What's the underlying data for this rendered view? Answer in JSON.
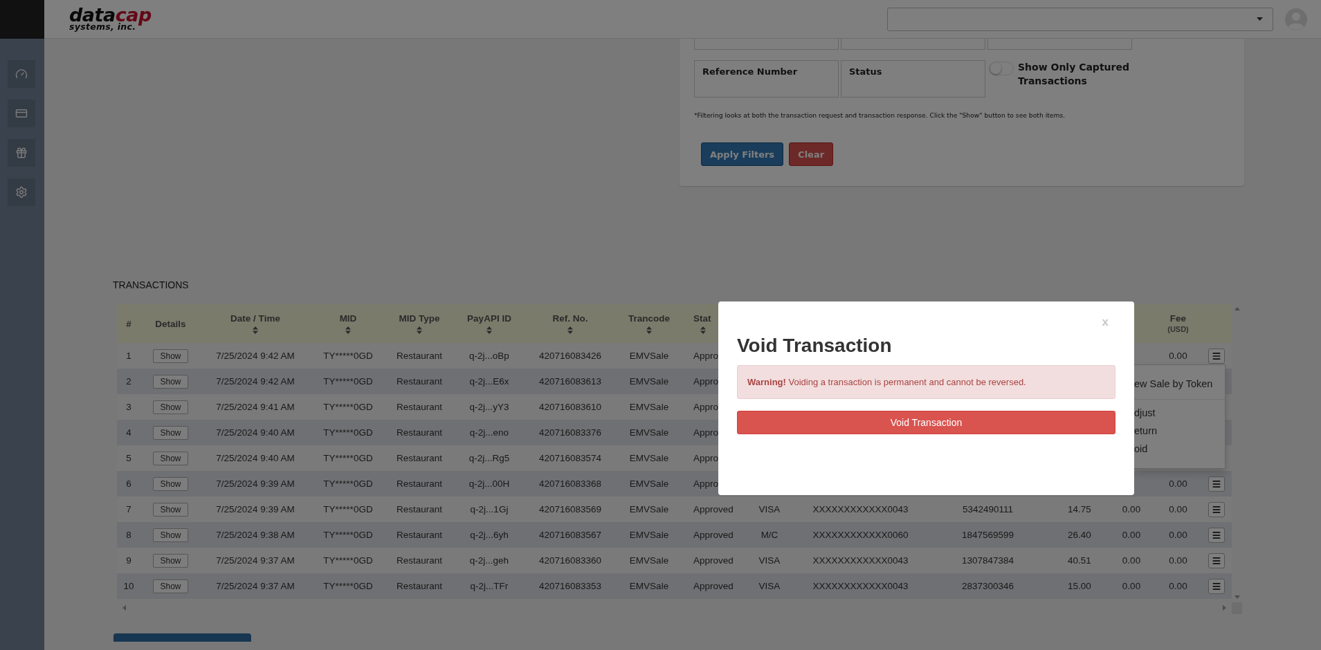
{
  "header": {
    "logo": {
      "part_1": "data",
      "part_2": "cap",
      "tagline": "systems, inc."
    }
  },
  "filters": {
    "fields": [
      {
        "label": "Reference Number"
      },
      {
        "label": "Status"
      }
    ],
    "captured_toggle": {
      "label": "Show Only Captured Transactions",
      "on": false
    },
    "note": "*Filtering looks at both the transaction request and transaction response. Click the \"Show\" button to see both items.",
    "buttons": [
      {
        "label": "Apply Filters",
        "kind": "primary"
      },
      {
        "label": "Clear",
        "kind": "danger"
      }
    ]
  },
  "transactions": {
    "title": "TRANSACTIONS",
    "columns": [
      {
        "label": "#",
        "sortable": false
      },
      {
        "label": "Details",
        "sortable": false
      },
      {
        "label": "Date / Time",
        "sortable": true
      },
      {
        "label": "MID",
        "sortable": true
      },
      {
        "label": "MID Type",
        "sortable": true
      },
      {
        "label": "PayAPI ID",
        "sortable": true
      },
      {
        "label": "Ref. No.",
        "sortable": true
      },
      {
        "label": "Trancode",
        "sortable": true
      },
      {
        "label": "Stat",
        "sortable": true
      },
      {
        "label": "Fee",
        "sub": "(USD)",
        "sortable": false
      }
    ],
    "rows": [
      {
        "number": "1",
        "details": "Show",
        "date_time": "7/25/2024 9:42 AM",
        "mid": "TY*****0GD",
        "mid_type": "Restaurant",
        "payapi_id": "q-2j...oBp",
        "ref_no": "420716083426",
        "trancode": "EMVSale",
        "status": "Appro",
        "fee": "0.00",
        "menu_button": true
      },
      {
        "number": "2",
        "details": "Show",
        "date_time": "7/25/2024 9:42 AM",
        "mid": "TY*****0GD",
        "mid_type": "Restaurant",
        "payapi_id": "q-2j...E6x",
        "ref_no": "420716083613",
        "trancode": "EMVSale",
        "status": "Appro",
        "menu_button": false
      },
      {
        "number": "3",
        "details": "Show",
        "date_time": "7/25/2024 9:41 AM",
        "mid": "TY*****0GD",
        "mid_type": "Restaurant",
        "payapi_id": "q-2j...yY3",
        "ref_no": "420716083610",
        "trancode": "EMVSale",
        "status": "Appro",
        "menu_button": false
      },
      {
        "number": "4",
        "details": "Show",
        "date_time": "7/25/2024 9:40 AM",
        "mid": "TY*****0GD",
        "mid_type": "Restaurant",
        "payapi_id": "q-2j...eno",
        "ref_no": "420716083376",
        "trancode": "EMVSale",
        "status": "Appro",
        "menu_button": false
      },
      {
        "number": "5",
        "details": "Show",
        "date_time": "7/25/2024 9:40 AM",
        "mid": "TY*****0GD",
        "mid_type": "Restaurant",
        "payapi_id": "q-2j...Rg5",
        "ref_no": "420716083574",
        "trancode": "EMVSale",
        "status": "Appro",
        "menu_button": false
      },
      {
        "number": "6",
        "details": "Show",
        "date_time": "7/25/2024 9:39 AM",
        "mid": "TY*****0GD",
        "mid_type": "Restaurant",
        "payapi_id": "q-2j...00H",
        "ref_no": "420716083368",
        "trancode": "EMVSale",
        "status": "Appro",
        "fee": "0.00",
        "menu_button": true
      },
      {
        "number": "7",
        "details": "Show",
        "date_time": "7/25/2024 9:39 AM",
        "mid": "TY*****0GD",
        "mid_type": "Restaurant",
        "payapi_id": "q-2j...1Gj",
        "ref_no": "420716083569",
        "trancode": "EMVSale",
        "status": "Approved",
        "card_type": "VISA",
        "card_number": "XXXXXXXXXXXX0043",
        "column_12": "5342490111",
        "column_13": "14.75",
        "column_14": "0.00",
        "fee": "0.00",
        "menu_button": true
      },
      {
        "number": "8",
        "details": "Show",
        "date_time": "7/25/2024 9:38 AM",
        "mid": "TY*****0GD",
        "mid_type": "Restaurant",
        "payapi_id": "q-2j...6yh",
        "ref_no": "420716083567",
        "trancode": "EMVSale",
        "status": "Approved",
        "card_type": "M/C",
        "card_number": "XXXXXXXXXXXX0060",
        "column_12": "1847569599",
        "column_13": "26.40",
        "column_14": "0.00",
        "fee": "0.00",
        "menu_button": true
      },
      {
        "number": "9",
        "details": "Show",
        "date_time": "7/25/2024 9:37 AM",
        "mid": "TY*****0GD",
        "mid_type": "Restaurant",
        "payapi_id": "q-2j...geh",
        "ref_no": "420716083360",
        "trancode": "EMVSale",
        "status": "Approved",
        "card_type": "VISA",
        "card_number": "XXXXXXXXXXXX0043",
        "column_12": "1307847384",
        "column_13": "40.51",
        "column_14": "0.00",
        "fee": "0.00",
        "menu_button": true
      },
      {
        "number": "10",
        "details": "Show",
        "date_time": "7/25/2024 9:37 AM",
        "mid": "TY*****0GD",
        "mid_type": "Restaurant",
        "payapi_id": "q-2j...TFr",
        "ref_no": "420716083353",
        "trancode": "EMVSale",
        "status": "Approved",
        "card_type": "VISA",
        "card_number": "XXXXXXXXXXXX0043",
        "column_12": "2837300346",
        "column_13": "15.00",
        "column_14": "0.00",
        "fee": "0.00",
        "menu_button": true
      }
    ]
  },
  "row_menu": {
    "groups": [
      [
        "ew Sale by Token"
      ],
      [
        "djust",
        "eturn",
        "oid"
      ]
    ]
  },
  "modal": {
    "close": "x",
    "title": "Void Transaction",
    "warning": "**Warning!** Voiding a transaction is permanent and cannot be reversed.",
    "button": "Void Transaction"
  }
}
